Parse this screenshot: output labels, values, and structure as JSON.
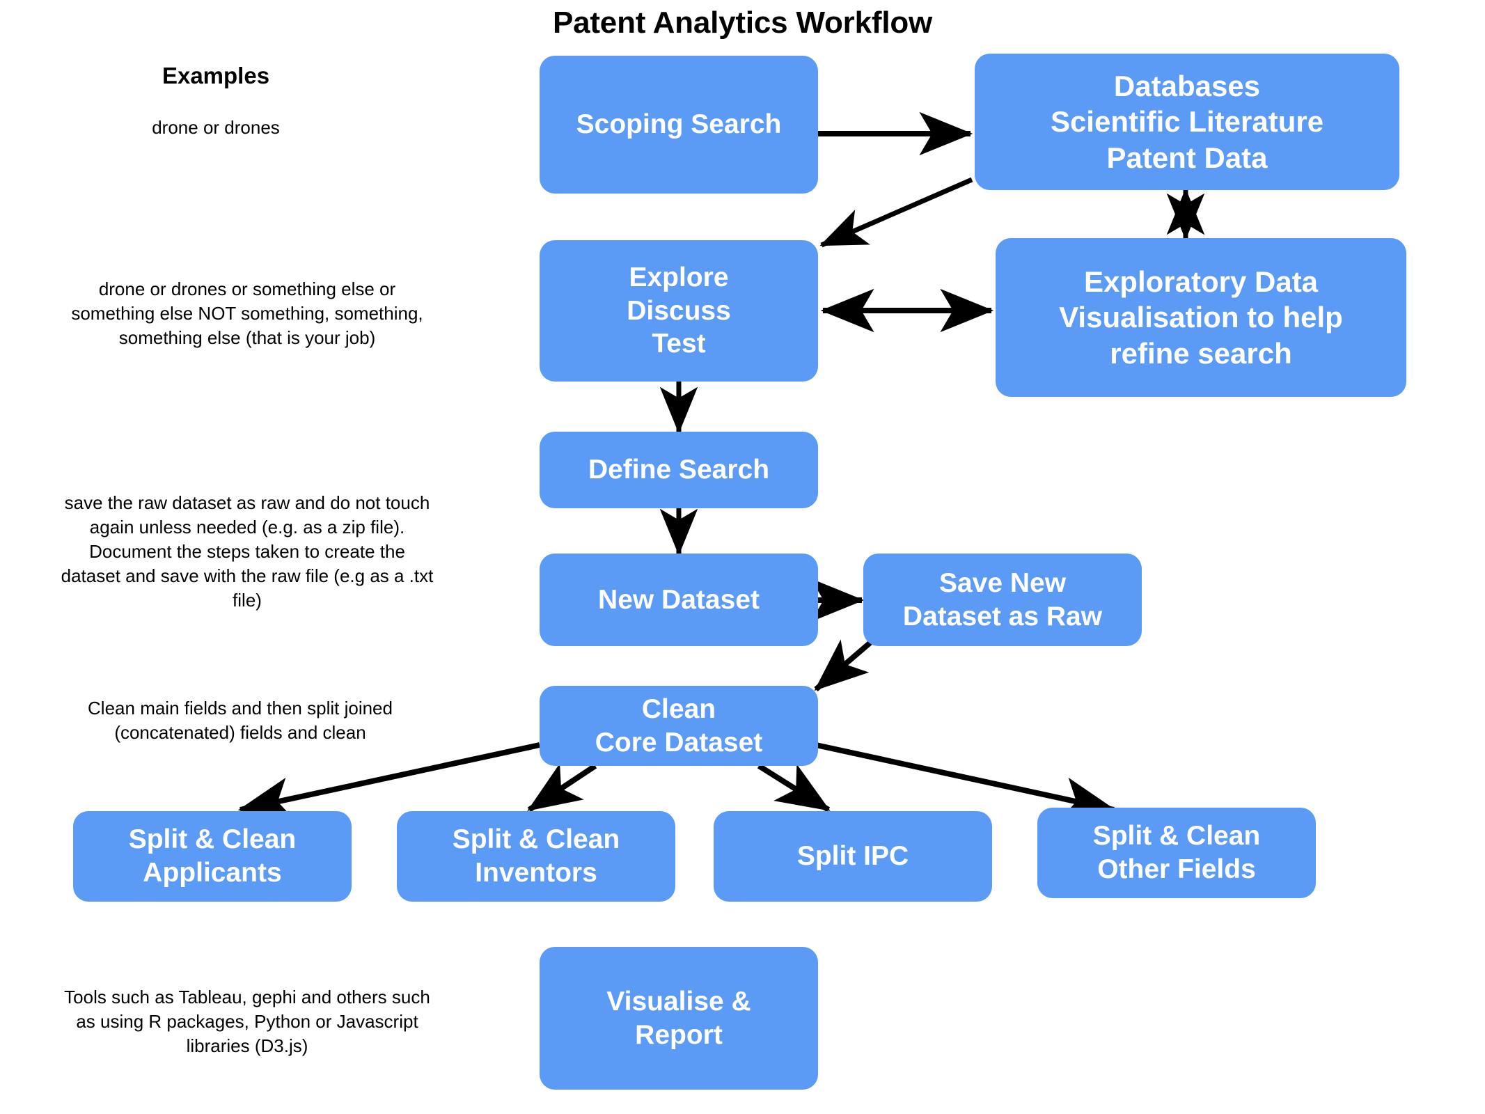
{
  "title": "Patent Analytics Workflow",
  "theme": {
    "node_fill": "#5b9bf5",
    "node_text": "#ffffff",
    "arrow_color": "#000000",
    "background": "#ffffff",
    "annotation_text": "#000000"
  },
  "annotations": {
    "heading": "Examples",
    "example_query": "drone or drones",
    "boolean_query": "drone or drones or something else or\nsomething else NOT something, something,\nsomething else (that is your job)",
    "raw_dataset_note": "save the raw dataset as raw and do not touch\nagain unless needed (e.g. as a zip file).\nDocument the steps taken to create the\ndataset and save with the raw file (e.g as a .txt\nfile)",
    "clean_fields_note": "Clean main fields and then split joined\n(concatenated) fields and clean",
    "tools_note": "Tools such as Tableau, gephi and others such\nas using R packages, Python or Javascript\nlibraries (D3.js)"
  },
  "nodes": {
    "scoping_search": "Scoping Search",
    "databases": "Databases\nScientific Literature\nPatent Data",
    "explore": "Explore\nDiscuss\nTest",
    "exploratory_viz": "Exploratory Data\nVisualisation to help\nrefine search",
    "define_search": "Define Search",
    "new_dataset": "New Dataset",
    "save_raw": "Save New\nDataset as Raw",
    "clean_core": "Clean\nCore Dataset",
    "split_applicants": "Split & Clean\nApplicants",
    "split_inventors": "Split & Clean\nInventors",
    "split_ipc": "Split IPC",
    "split_other": "Split & Clean\nOther Fields",
    "visualise_report": "Visualise &\nReport"
  },
  "edges": [
    {
      "from": "scoping_search",
      "to": "databases",
      "type": "single"
    },
    {
      "from": "databases",
      "to": "explore",
      "type": "single"
    },
    {
      "from": "databases",
      "to": "exploratory_viz",
      "type": "double"
    },
    {
      "from": "explore",
      "to": "exploratory_viz",
      "type": "double"
    },
    {
      "from": "explore",
      "to": "define_search",
      "type": "single"
    },
    {
      "from": "define_search",
      "to": "new_dataset",
      "type": "single"
    },
    {
      "from": "new_dataset",
      "to": "save_raw",
      "type": "single"
    },
    {
      "from": "save_raw",
      "to": "clean_core",
      "type": "single"
    },
    {
      "from": "clean_core",
      "to": "split_applicants",
      "type": "single"
    },
    {
      "from": "clean_core",
      "to": "split_inventors",
      "type": "single"
    },
    {
      "from": "clean_core",
      "to": "split_ipc",
      "type": "single"
    },
    {
      "from": "clean_core",
      "to": "split_other",
      "type": "single"
    }
  ]
}
